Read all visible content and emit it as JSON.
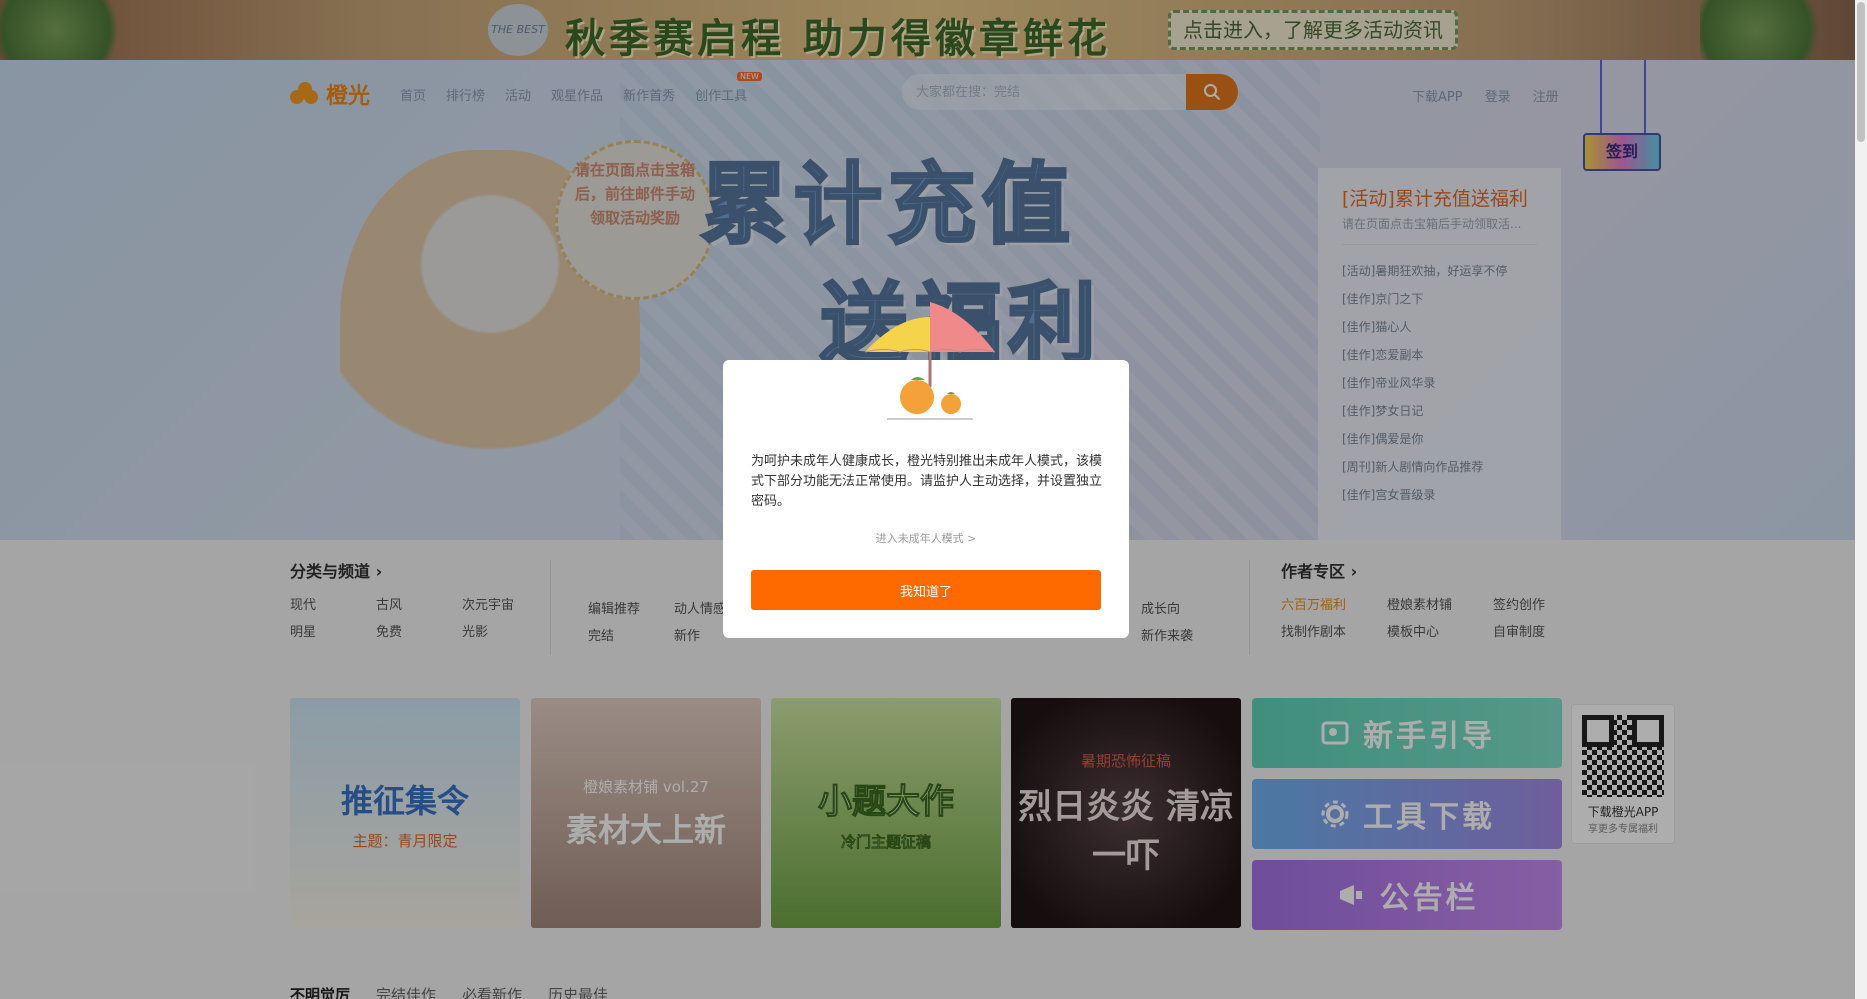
{
  "promo_banner": {
    "badge_text": "THE BEST",
    "title": "秋季赛启程 助力得徽章鲜花",
    "cta": "点击进入，了解更多活动资讯"
  },
  "header": {
    "logo_text": "橙光",
    "nav": [
      "首页",
      "排行榜",
      "活动",
      "观星作品",
      "新作首秀",
      "创作工具"
    ],
    "new_badge": "NEW",
    "search_placeholder": "大家都在搜：完结",
    "right_links": [
      "下载APP",
      "登录",
      "注册"
    ],
    "hang_sign": "签到"
  },
  "hero": {
    "bubble_text": "请在页面点击宝箱后，前往邮件手动领取活动奖励",
    "title_line1": "累计充值",
    "title_line2": "送福利"
  },
  "news_panel": {
    "headline": "[活动]累计充值送福利",
    "subline": "请在页面点击宝箱后手动领取活...",
    "items": [
      "[活动]暑期狂欢抽，好运享不停",
      "[佳作]京门之下",
      "[佳作]猫心人",
      "[佳作]恋爱副本",
      "[佳作]帝业风华录",
      "[佳作]梦女日记",
      "[佳作]偶爱是你",
      "[周刊]新人剧情向作品推荐",
      "[佳作]宫女晋级录"
    ]
  },
  "categories": {
    "title": "分类与频道",
    "col1": [
      "现代",
      "古风",
      "次元宇宙",
      "明星",
      "免费",
      "光影"
    ],
    "col2": [
      "编辑推荐",
      "动人情感",
      "完结",
      "新作"
    ],
    "col3": [
      "成长向",
      "新作来袭"
    ]
  },
  "author_zone": {
    "title": "作者专区",
    "items": [
      "六百万福利",
      "橙娘素材铺",
      "签约创作",
      "找制作剧本",
      "模板中心",
      "自审制度"
    ]
  },
  "tiles": [
    {
      "title": "推征集令",
      "sub": "主题：青月限定"
    },
    {
      "title": "素材大上新",
      "sub": "橙娘素材铺 vol.27"
    },
    {
      "title": "小题大作",
      "sub": "冷门主题征稿"
    },
    {
      "title": "烈日炎炎 清凉一吓",
      "sub": "暑期恐怖征稿"
    }
  ],
  "tools": [
    "新手引导",
    "工具下载",
    "公告栏"
  ],
  "qr": {
    "line1": "下载橙光APP",
    "line2": "享更多专属福利"
  },
  "bottom_tabs": [
    "不明觉厉",
    "完结佳作",
    "必看新作",
    "历史最佳"
  ],
  "modal": {
    "message": "为呵护未成年人健康成长，橙光特别推出未成年人模式，该模式下部分功能无法正常使用。请监护人主动选择，并设置独立密码。",
    "minor_link": "进入未成年人模式 >",
    "ok_button": "我知道了"
  },
  "colors": {
    "brand_orange": "#ff6a00",
    "news_headline": "#e46a28"
  }
}
